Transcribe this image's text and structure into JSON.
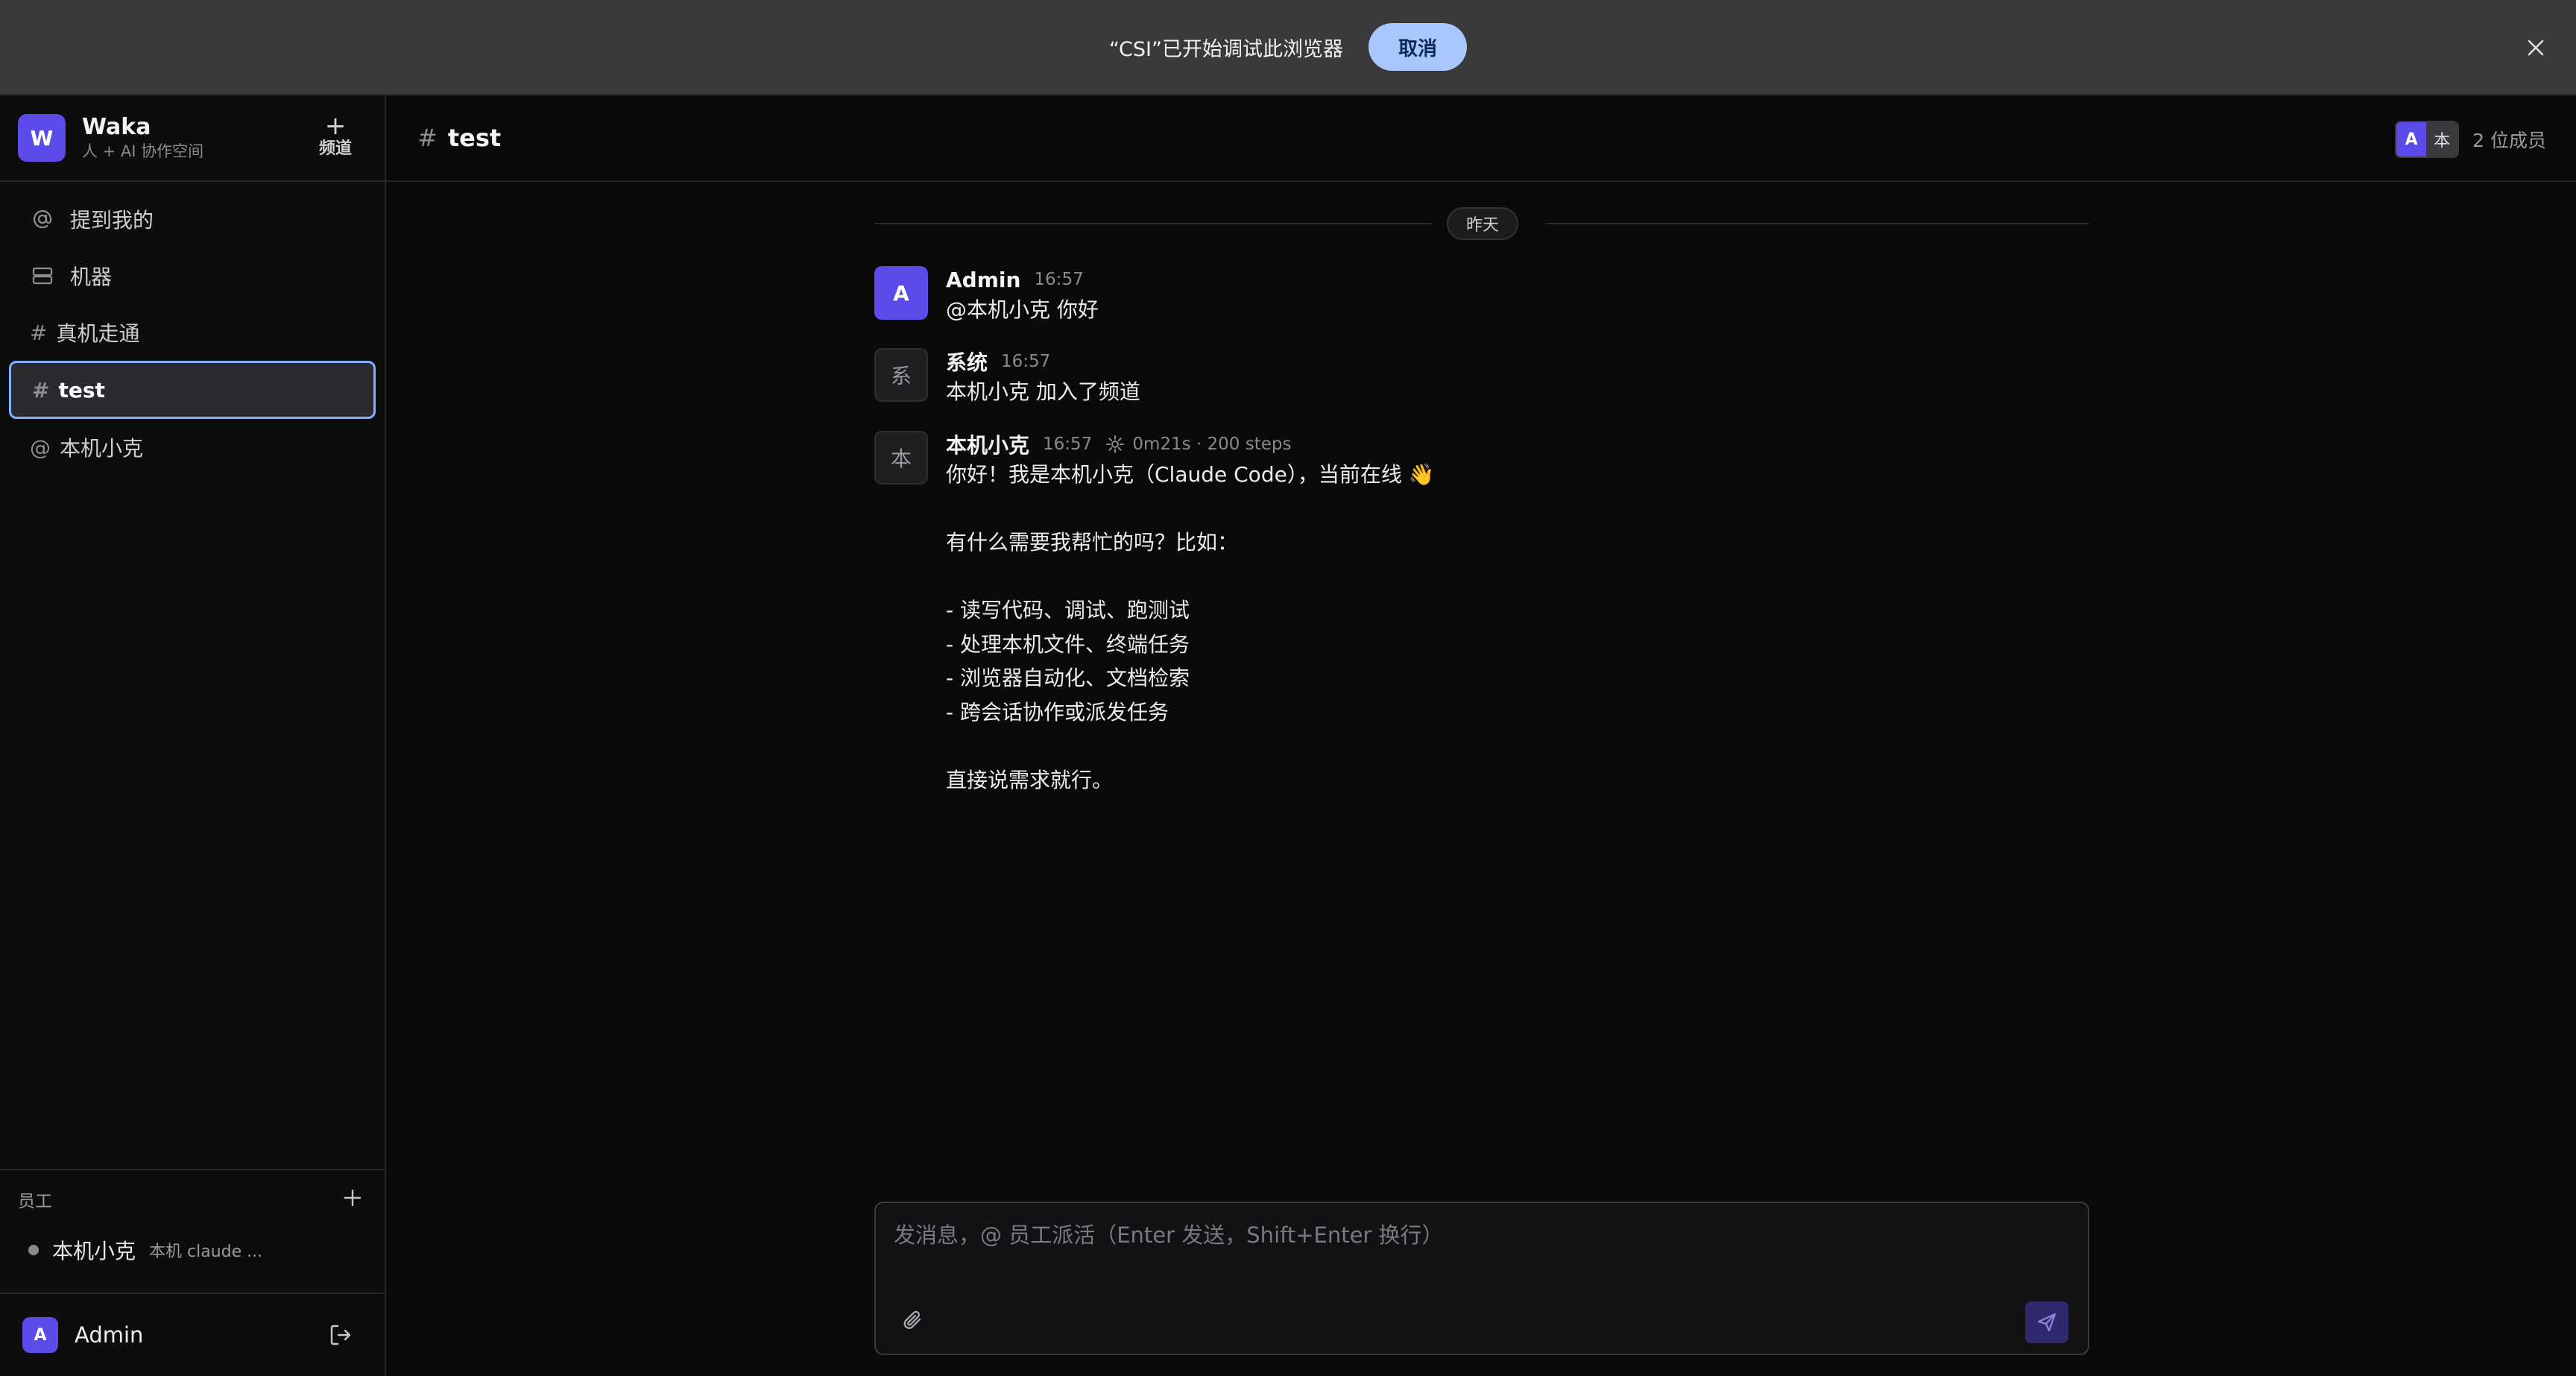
{
  "banner": {
    "text": "“CSI”已开始调试此浏览器",
    "cancel_label": "取消"
  },
  "workspace": {
    "avatar_letter": "W",
    "name": "Waka",
    "subtitle": "人 + AI 协作空间",
    "add_plus": "+",
    "add_label": "频道"
  },
  "nav": {
    "mentions": "提到我的",
    "machines": "机器"
  },
  "channels": [
    {
      "hash": "#",
      "label": "真机走通",
      "active": false
    },
    {
      "hash": "#",
      "label": "test",
      "active": true
    },
    {
      "hash": "@",
      "label": "本机小克",
      "active": false
    }
  ],
  "staff": {
    "heading": "员工",
    "members": [
      {
        "name": "本机小克",
        "desc": "本机 claude ..."
      }
    ]
  },
  "current_user": {
    "avatar_letter": "A",
    "name": "Admin"
  },
  "channel": {
    "hash": "#",
    "title": "test",
    "member_avatars": [
      "A",
      "本"
    ],
    "member_count": "2 位成员"
  },
  "day_divider": "昨天",
  "messages": [
    {
      "avatar": "A",
      "author": "Admin",
      "time": "16:57",
      "extra": "",
      "text": "@本机小克 你好"
    },
    {
      "avatar": "系",
      "author": "系统",
      "time": "16:57",
      "extra": "",
      "text": "本机小克 加入了频道"
    },
    {
      "avatar": "本",
      "author": "本机小克",
      "time": "16:57",
      "extra": "0m21s · 200 steps",
      "text": "你好！我是本机小克（Claude Code），当前在线 👋\n\n有什么需要我帮忙的吗？比如：\n\n- 读写代码、调试、跑测试\n- 处理本机文件、终端任务\n- 浏览器自动化、文档检索\n- 跨会话协作或派发任务\n\n直接说需求就行。"
    }
  ],
  "composer": {
    "placeholder": "发消息，@ 员工派活（Enter 发送，Shift+Enter 换行）",
    "value": ""
  },
  "colors": {
    "accent": "#5b4be8",
    "active_border": "#7fb0ff",
    "banner_button": "#a8c7fa"
  }
}
